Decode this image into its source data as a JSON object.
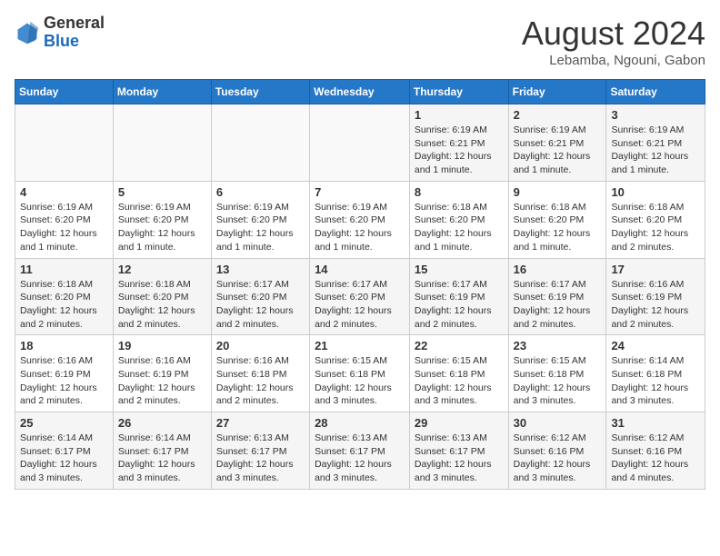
{
  "logo": {
    "general": "General",
    "blue": "Blue"
  },
  "title": {
    "month_year": "August 2024",
    "location": "Lebamba, Ngouni, Gabon"
  },
  "days_of_week": [
    "Sunday",
    "Monday",
    "Tuesday",
    "Wednesday",
    "Thursday",
    "Friday",
    "Saturday"
  ],
  "weeks": [
    [
      {
        "day": "",
        "info": ""
      },
      {
        "day": "",
        "info": ""
      },
      {
        "day": "",
        "info": ""
      },
      {
        "day": "",
        "info": ""
      },
      {
        "day": "1",
        "info": "Sunrise: 6:19 AM\nSunset: 6:21 PM\nDaylight: 12 hours and 1 minute."
      },
      {
        "day": "2",
        "info": "Sunrise: 6:19 AM\nSunset: 6:21 PM\nDaylight: 12 hours and 1 minute."
      },
      {
        "day": "3",
        "info": "Sunrise: 6:19 AM\nSunset: 6:21 PM\nDaylight: 12 hours and 1 minute."
      }
    ],
    [
      {
        "day": "4",
        "info": "Sunrise: 6:19 AM\nSunset: 6:20 PM\nDaylight: 12 hours and 1 minute."
      },
      {
        "day": "5",
        "info": "Sunrise: 6:19 AM\nSunset: 6:20 PM\nDaylight: 12 hours and 1 minute."
      },
      {
        "day": "6",
        "info": "Sunrise: 6:19 AM\nSunset: 6:20 PM\nDaylight: 12 hours and 1 minute."
      },
      {
        "day": "7",
        "info": "Sunrise: 6:19 AM\nSunset: 6:20 PM\nDaylight: 12 hours and 1 minute."
      },
      {
        "day": "8",
        "info": "Sunrise: 6:18 AM\nSunset: 6:20 PM\nDaylight: 12 hours and 1 minute."
      },
      {
        "day": "9",
        "info": "Sunrise: 6:18 AM\nSunset: 6:20 PM\nDaylight: 12 hours and 1 minute."
      },
      {
        "day": "10",
        "info": "Sunrise: 6:18 AM\nSunset: 6:20 PM\nDaylight: 12 hours and 2 minutes."
      }
    ],
    [
      {
        "day": "11",
        "info": "Sunrise: 6:18 AM\nSunset: 6:20 PM\nDaylight: 12 hours and 2 minutes."
      },
      {
        "day": "12",
        "info": "Sunrise: 6:18 AM\nSunset: 6:20 PM\nDaylight: 12 hours and 2 minutes."
      },
      {
        "day": "13",
        "info": "Sunrise: 6:17 AM\nSunset: 6:20 PM\nDaylight: 12 hours and 2 minutes."
      },
      {
        "day": "14",
        "info": "Sunrise: 6:17 AM\nSunset: 6:20 PM\nDaylight: 12 hours and 2 minutes."
      },
      {
        "day": "15",
        "info": "Sunrise: 6:17 AM\nSunset: 6:19 PM\nDaylight: 12 hours and 2 minutes."
      },
      {
        "day": "16",
        "info": "Sunrise: 6:17 AM\nSunset: 6:19 PM\nDaylight: 12 hours and 2 minutes."
      },
      {
        "day": "17",
        "info": "Sunrise: 6:16 AM\nSunset: 6:19 PM\nDaylight: 12 hours and 2 minutes."
      }
    ],
    [
      {
        "day": "18",
        "info": "Sunrise: 6:16 AM\nSunset: 6:19 PM\nDaylight: 12 hours and 2 minutes."
      },
      {
        "day": "19",
        "info": "Sunrise: 6:16 AM\nSunset: 6:19 PM\nDaylight: 12 hours and 2 minutes."
      },
      {
        "day": "20",
        "info": "Sunrise: 6:16 AM\nSunset: 6:18 PM\nDaylight: 12 hours and 2 minutes."
      },
      {
        "day": "21",
        "info": "Sunrise: 6:15 AM\nSunset: 6:18 PM\nDaylight: 12 hours and 3 minutes."
      },
      {
        "day": "22",
        "info": "Sunrise: 6:15 AM\nSunset: 6:18 PM\nDaylight: 12 hours and 3 minutes."
      },
      {
        "day": "23",
        "info": "Sunrise: 6:15 AM\nSunset: 6:18 PM\nDaylight: 12 hours and 3 minutes."
      },
      {
        "day": "24",
        "info": "Sunrise: 6:14 AM\nSunset: 6:18 PM\nDaylight: 12 hours and 3 minutes."
      }
    ],
    [
      {
        "day": "25",
        "info": "Sunrise: 6:14 AM\nSunset: 6:17 PM\nDaylight: 12 hours and 3 minutes."
      },
      {
        "day": "26",
        "info": "Sunrise: 6:14 AM\nSunset: 6:17 PM\nDaylight: 12 hours and 3 minutes."
      },
      {
        "day": "27",
        "info": "Sunrise: 6:13 AM\nSunset: 6:17 PM\nDaylight: 12 hours and 3 minutes."
      },
      {
        "day": "28",
        "info": "Sunrise: 6:13 AM\nSunset: 6:17 PM\nDaylight: 12 hours and 3 minutes."
      },
      {
        "day": "29",
        "info": "Sunrise: 6:13 AM\nSunset: 6:17 PM\nDaylight: 12 hours and 3 minutes."
      },
      {
        "day": "30",
        "info": "Sunrise: 6:12 AM\nSunset: 6:16 PM\nDaylight: 12 hours and 3 minutes."
      },
      {
        "day": "31",
        "info": "Sunrise: 6:12 AM\nSunset: 6:16 PM\nDaylight: 12 hours and 4 minutes."
      }
    ]
  ]
}
